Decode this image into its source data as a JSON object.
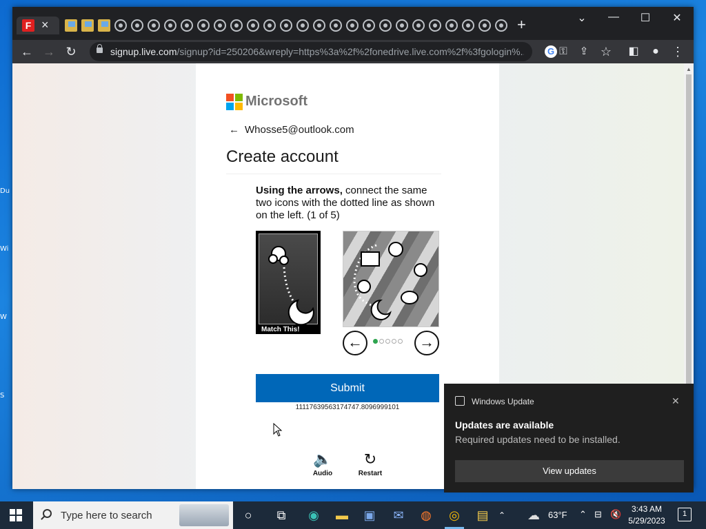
{
  "browser": {
    "active_tab_icon": "F",
    "url_host": "signup.live.com",
    "url_path": "/signup?id=250206&wreply=https%3a%2f%2fonedrive.live.com%2f%3fgologin%..."
  },
  "page": {
    "brand": "Microsoft",
    "email": "Whosse5@outlook.com",
    "title": "Create account",
    "instruction_bold": "Using the arrows,",
    "instruction_rest": " connect the same two icons with the dotted line as shown on the left. (1 of 5)",
    "match_label": "Match This!",
    "submit_label": "Submit",
    "session_id": "11117639563174747.8096999101",
    "audio_label": "Audio",
    "restart_label": "Restart",
    "puzzle_step": 1,
    "puzzle_total": 5
  },
  "notification": {
    "app": "Windows Update",
    "title": "Updates are available",
    "body": "Required updates need to be installed.",
    "button": "View updates"
  },
  "taskbar": {
    "search_placeholder": "Type here to search",
    "weather": "63°F",
    "time": "3:43 AM",
    "date": "5/29/2023",
    "notification_count": "1"
  },
  "desktop_labels": [
    "Du",
    "Wi",
    "W",
    "S"
  ],
  "colors": {
    "ms_red": "#f25022",
    "ms_green": "#7fba00",
    "ms_blue": "#00a4ef",
    "ms_yellow": "#ffb900",
    "submit_blue": "#0067b8",
    "progress_green": "#2ea44f"
  }
}
